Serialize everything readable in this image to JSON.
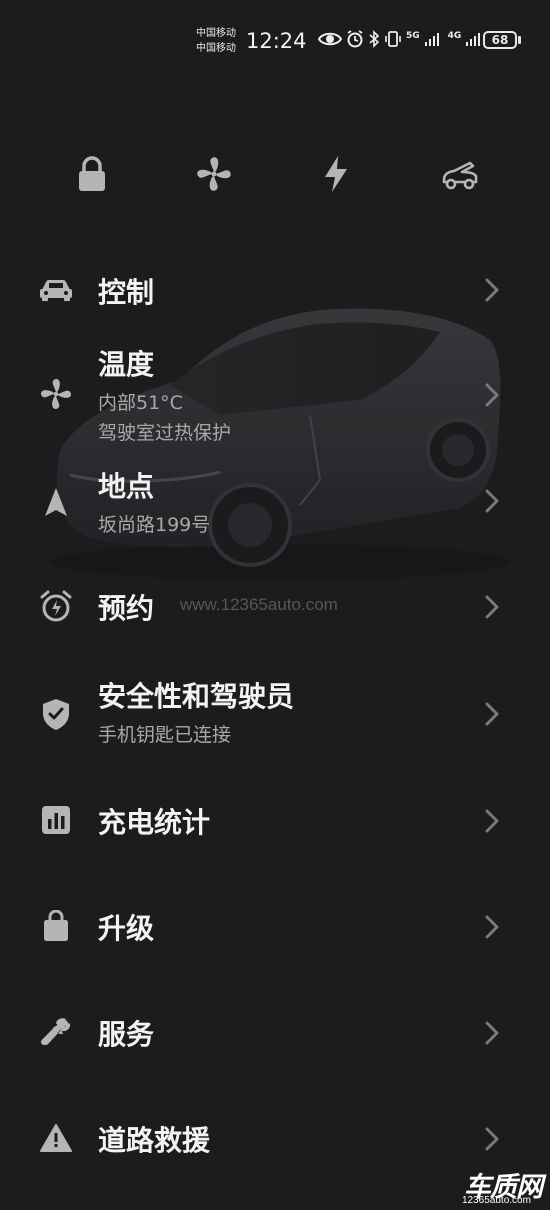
{
  "status_bar": {
    "carrier_1": "中国移动",
    "carrier_2": "中国移动",
    "time": "12:24",
    "network_1": "5G",
    "network_2": "4G",
    "battery": "68"
  },
  "quick_actions": [
    {
      "icon": "lock-icon"
    },
    {
      "icon": "fan-icon"
    },
    {
      "icon": "lightning-icon"
    },
    {
      "icon": "car-frunk-icon"
    }
  ],
  "menu": {
    "controls": {
      "title": "控制",
      "icon": "car-icon"
    },
    "climate": {
      "title": "温度",
      "sub1": "内部51°C",
      "sub2": "驾驶室过热保护",
      "icon": "fan-icon"
    },
    "location": {
      "title": "地点",
      "sub1": "坂尚路199号",
      "icon": "navigation-arrow-icon"
    },
    "schedule": {
      "title": "预约",
      "icon": "alarm-clock-icon"
    },
    "safety": {
      "title": "安全性和驾驶员",
      "sub1": "手机钥匙已连接",
      "icon": "shield-check-icon"
    },
    "charging": {
      "title": "充电统计",
      "icon": "bar-chart-icon"
    },
    "upgrades": {
      "title": "升级",
      "icon": "shopping-bag-icon"
    },
    "service": {
      "title": "服务",
      "icon": "wrench-icon"
    },
    "roadside": {
      "title": "道路救援",
      "icon": "warning-triangle-icon"
    }
  },
  "watermark": {
    "url": "www.12365auto.com",
    "logo_text": "车质网",
    "logo_url": "12365auto.com"
  },
  "colors": {
    "background": "#1b1c1e",
    "text_primary": "#f3f3f3",
    "text_secondary": "#a8a8a8",
    "icon": "#b5b5b5",
    "chevron": "#7a7a7a"
  }
}
